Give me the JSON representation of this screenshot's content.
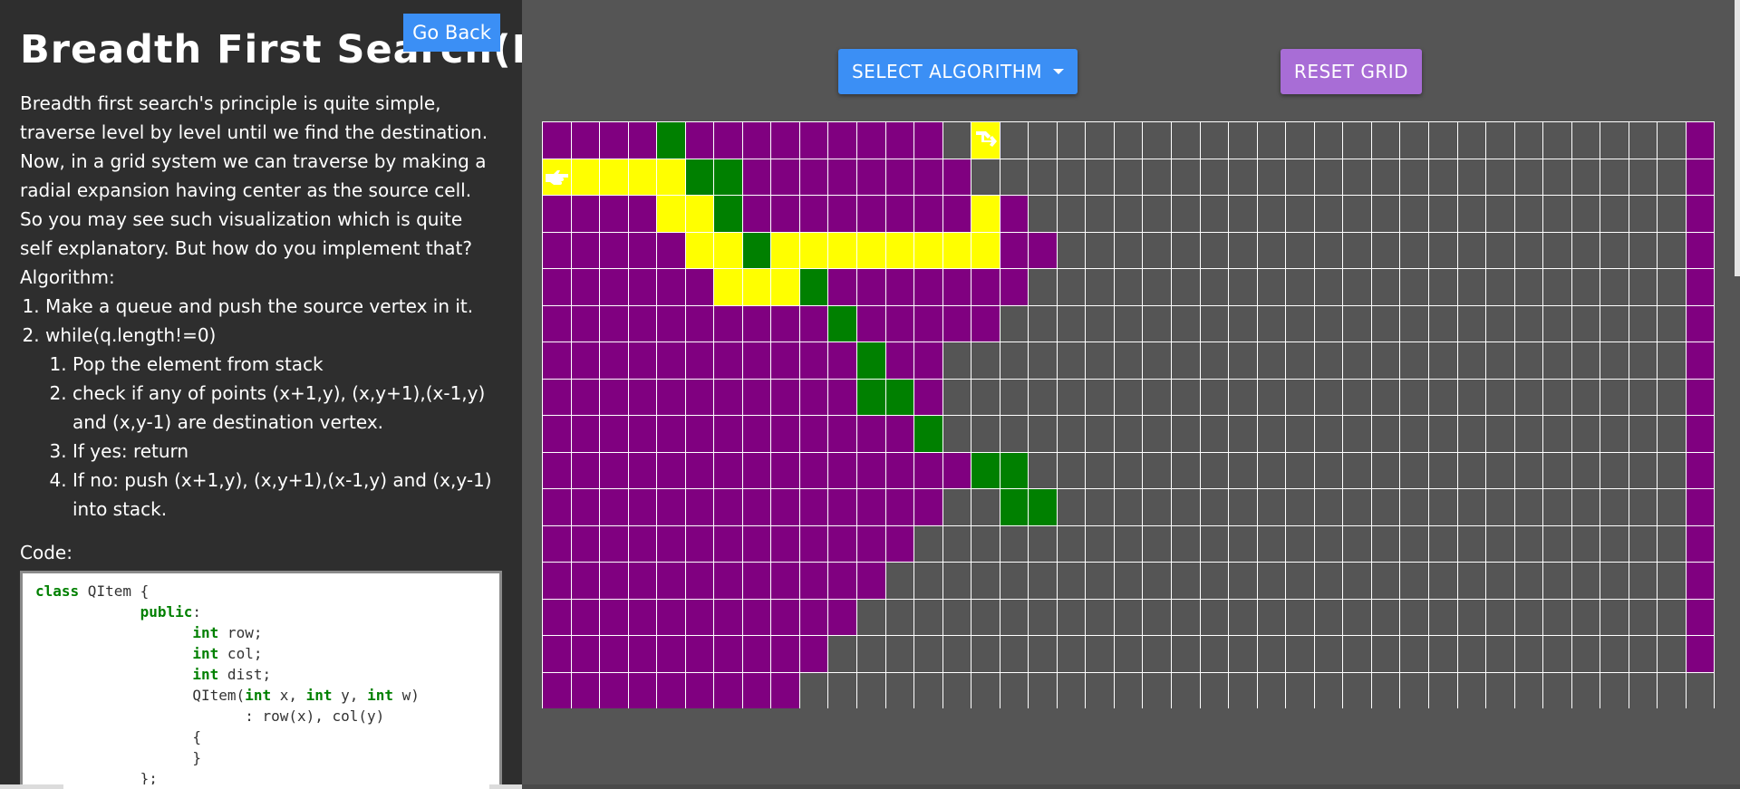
{
  "left_panel": {
    "title": "Breadth First Search(BFS)",
    "go_back_label": "Go Back",
    "intro_lines": [
      "Breadth first search's principle is quite simple,",
      "traverse level by level until we find the destination.",
      "Now, in a grid system we can traverse by making a",
      "radial expansion having center as the source cell.",
      "So you may see such visualization which is quite",
      "self explanatory. But how do you implement that?",
      "Algorithm:"
    ],
    "steps": [
      "Make a queue and push the source vertex in it.",
      "while(q.length!=0)"
    ],
    "substeps": [
      "Pop the element from stack",
      "check if any of points (x+1,y), (x,y+1),(x-1,y) and (x,y-1) are destination vertex.",
      "If yes: return",
      "If no: push  (x+1,y), (x,y+1),(x-1,y) and (x,y-1) into stack."
    ],
    "code_label": "Code:",
    "code_lines": [
      [
        {
          "t": "class",
          "k": true
        },
        {
          "t": " QItem {",
          "k": false
        }
      ],
      [
        {
          "t": "            ",
          "k": false
        },
        {
          "t": "public",
          "k": true
        },
        {
          "t": ":",
          "k": false
        }
      ],
      [
        {
          "t": "                  ",
          "k": false
        },
        {
          "t": "int",
          "k": true
        },
        {
          "t": " row;",
          "k": false
        }
      ],
      [
        {
          "t": "                  ",
          "k": false
        },
        {
          "t": "int",
          "k": true
        },
        {
          "t": " col;",
          "k": false
        }
      ],
      [
        {
          "t": "                  ",
          "k": false
        },
        {
          "t": "int",
          "k": true
        },
        {
          "t": " dist;",
          "k": false
        }
      ],
      [
        {
          "t": "                  QItem(",
          "k": false
        },
        {
          "t": "int",
          "k": true
        },
        {
          "t": " x, ",
          "k": false
        },
        {
          "t": "int",
          "k": true
        },
        {
          "t": " y, ",
          "k": false
        },
        {
          "t": "int",
          "k": true
        },
        {
          "t": " w)",
          "k": false
        }
      ],
      [
        {
          "t": "                        : row(x), col(y)",
          "k": false
        }
      ],
      [
        {
          "t": "                  {",
          "k": false
        }
      ],
      [
        {
          "t": "                  }",
          "k": false
        }
      ],
      [
        {
          "t": "            };",
          "k": false
        }
      ]
    ]
  },
  "toolbar": {
    "select_algorithm_label": "SELECT ALGORITHM",
    "reset_grid_label": "RESET GRID"
  },
  "colors": {
    "visited": "#800080",
    "path": "#ffff00",
    "wall": "#008000",
    "empty": "#555555",
    "source_icon": "#ffffff",
    "destination_icon": "#ffffff"
  },
  "grid": {
    "rows": 16,
    "cols": 41,
    "legend": {
      "V": "visited",
      "Y": "path",
      "W": "wall",
      "E": "empty",
      "S": "source",
      "D": "destination"
    },
    "icons": {
      "S": "pointing-hand-icon",
      "D": "destination-arrow-icon"
    },
    "cells": [
      "VVVVWVVVVVVVVVEDEEEEEEEEEEEEEEEEEEEEEEEEV",
      "SYYYYWWVVVVVVVVEEEEEEEEEEEEEEEEEEEEEEEEEV",
      "VVVVYYWVVVVVVVVYVEEEEEEEEEEEEEEEEEEEEEEEV",
      "VVVVVYYWYYYYYYYYVVEEEEEEEEEEEEEEEEEEEEEEV",
      "VVVVVVYYYWVVVVVVVEEEEEEEEEEEEEEEEEEEEEEEV",
      "VVVVVVVVVVWVVVVVEEEEEEEEEEEEEEEEEEEEEEEEV",
      "VVVVVVVVVVVWVVEEEEEEEEEEEEEEEEEEEEEEEEEEV",
      "VVVVVVVVVVVWWVEEEEEEEEEEEEEEEEEEEEEEEEEEV",
      "VVVVVVVVVVVVVWEEEEEEEEEEEEEEEEEEEEEEEEEEV",
      "VVVVVVVVVVVVVVVWWEEEEEEEEEEEEEEEEEEEEEEEV",
      "VVVVVVVVVVVVVVEEWWEEEEEEEEEEEEEEEEEEEEEEV",
      "VVVVVVVVVVVVVEEEEEEEEEEEEEEEEEEEEEEEEEEEV",
      "VVVVVVVVVVVVEEEEEEEEEEEEEEEEEEEEEEEEEEEEV",
      "VVVVVVVVVVVEEEEEEEEEEEEEEEEEEEEEEEEEEEEEV",
      "VVVVVVVVVVEEEEEEEEEEEEEEEEEEEEEEEEEEEEEEV",
      "VVVVVVVVVEEEEEEEEEEEEEEEEEEEEEEEEEEEEEEEE"
    ]
  }
}
